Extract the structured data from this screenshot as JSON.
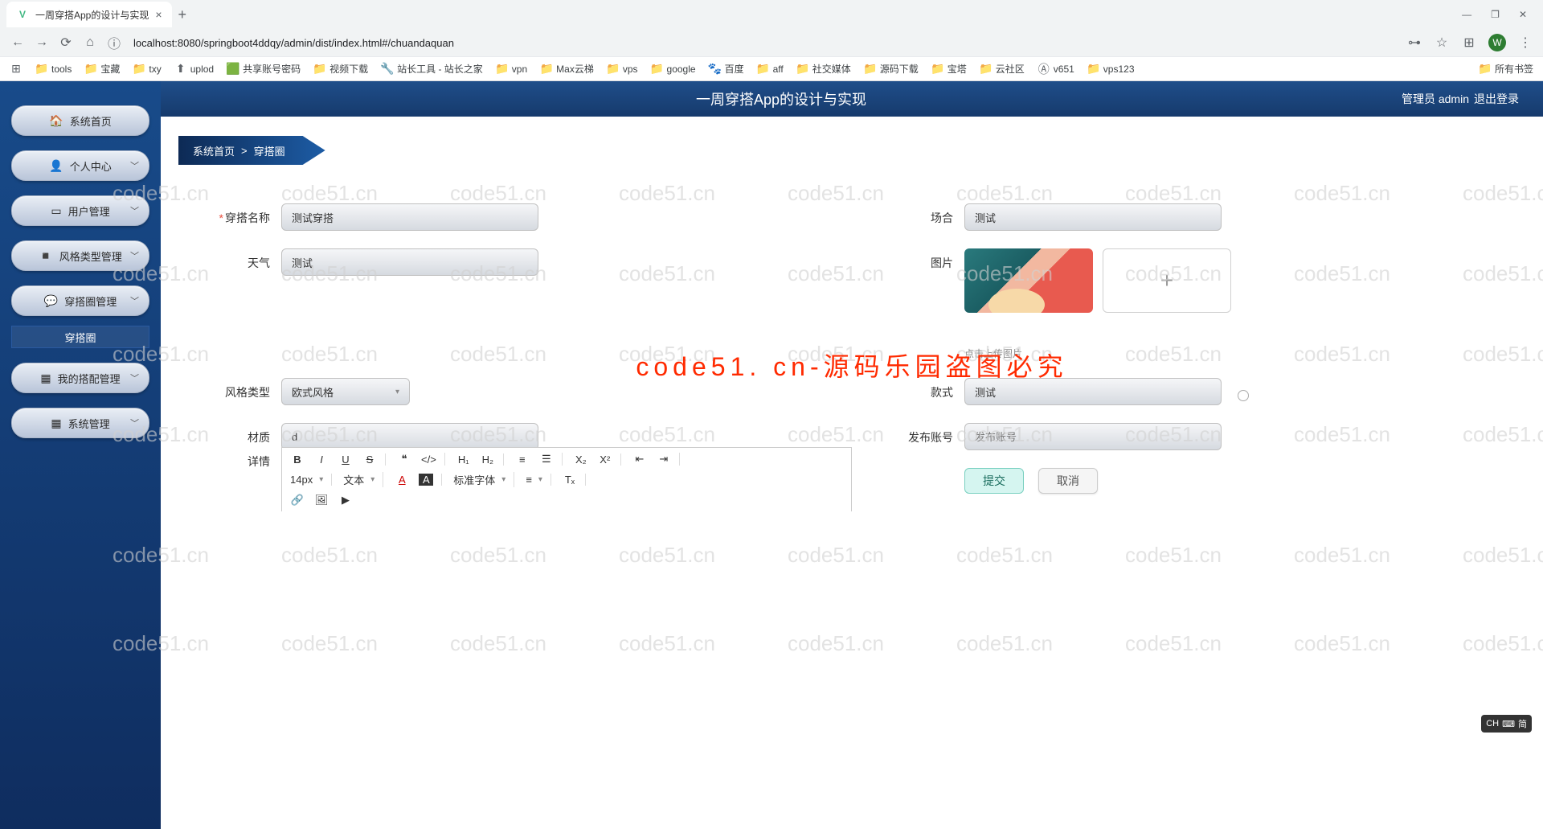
{
  "browser": {
    "tab_title": "一周穿搭App的设计与实现",
    "url": "localhost:8080/springboot4ddqy/admin/dist/index.html#/chuandaquan",
    "win": {
      "min": "—",
      "max": "❐",
      "close": "✕"
    },
    "nav": {
      "back": "←",
      "fwd": "→",
      "reload": "⟳",
      "home": "⌂",
      "info": "ⓘ"
    },
    "right": {
      "extensions": "⊞",
      "avatar": "W",
      "menu": "⋮"
    },
    "all_bookmarks": "所有书签",
    "bookmarks": [
      {
        "icon": "⊞",
        "label": ""
      },
      {
        "icon": "📁",
        "label": "tools"
      },
      {
        "icon": "📁",
        "label": "宝藏"
      },
      {
        "icon": "📁",
        "label": "txy"
      },
      {
        "icon": "⬆",
        "label": "uplod"
      },
      {
        "icon": "🟩",
        "label": "共享账号密码"
      },
      {
        "icon": "📁",
        "label": "视频下载"
      },
      {
        "icon": "🔧",
        "label": "站长工具 - 站长之家"
      },
      {
        "icon": "📁",
        "label": "vpn"
      },
      {
        "icon": "📁",
        "label": "Max云梯"
      },
      {
        "icon": "📁",
        "label": "vps"
      },
      {
        "icon": "📁",
        "label": "google"
      },
      {
        "icon": "🐾",
        "label": "百度"
      },
      {
        "icon": "📁",
        "label": "aff"
      },
      {
        "icon": "📁",
        "label": "社交媒体"
      },
      {
        "icon": "📁",
        "label": "源码下载"
      },
      {
        "icon": "📁",
        "label": "宝塔"
      },
      {
        "icon": "📁",
        "label": "云社区"
      },
      {
        "icon": "Ⓐ",
        "label": "v651"
      },
      {
        "icon": "📁",
        "label": "vps123"
      }
    ]
  },
  "header": {
    "title": "一周穿搭App的设计与实现",
    "user_label": "管理员 admin",
    "logout": "退出登录"
  },
  "sidebar": {
    "home": "系统首页",
    "personal": "个人中心",
    "user_mgmt": "用户管理",
    "style_type": "风格类型管理",
    "outfit_circle": "穿搭圈管理",
    "outfit_sub": "穿搭圈",
    "my_match": "我的搭配管理",
    "sys_mgmt": "系统管理"
  },
  "breadcrumb": {
    "home": "系统首页",
    "sep": ">",
    "current": "穿搭圈"
  },
  "form": {
    "name_label": "穿搭名称",
    "name_value": "测试穿搭",
    "occasion_label": "场合",
    "occasion_value": "测试",
    "weather_label": "天气",
    "weather_value": "测试",
    "image_label": "图片",
    "upload_hint": "点击上传图片",
    "style_type_label": "风格类型",
    "style_type_value": "欧式风格",
    "style_label": "款式",
    "style_value": "测试",
    "material_label": "材质",
    "material_value": "d",
    "publisher_label": "发布账号",
    "publisher_placeholder": "发布账号",
    "detail_label": "详情",
    "submit": "提交",
    "cancel": "取消"
  },
  "editor": {
    "font_size": "14px",
    "text_type": "文本",
    "font_family": "标准字体",
    "bold": "B",
    "italic": "I",
    "underline": "U",
    "strike": "S",
    "quote": "❝",
    "code": "</>",
    "h1": "H₁",
    "h2": "H₂",
    "ol": "≡",
    "ul": "☰",
    "sub": "X₂",
    "sup": "X²",
    "indent_dec": "⇤",
    "indent_inc": "⇥",
    "color": "A",
    "bg": "A",
    "align": "≡",
    "clear": "Tₓ",
    "link": "🔗",
    "image": "🖼",
    "video": "▶"
  },
  "watermark": {
    "text": "code51.cn",
    "center": "code51. cn-源码乐园盗图必究"
  },
  "ime": {
    "lang": "CH",
    "mode": "⌨",
    "sub": "简"
  }
}
